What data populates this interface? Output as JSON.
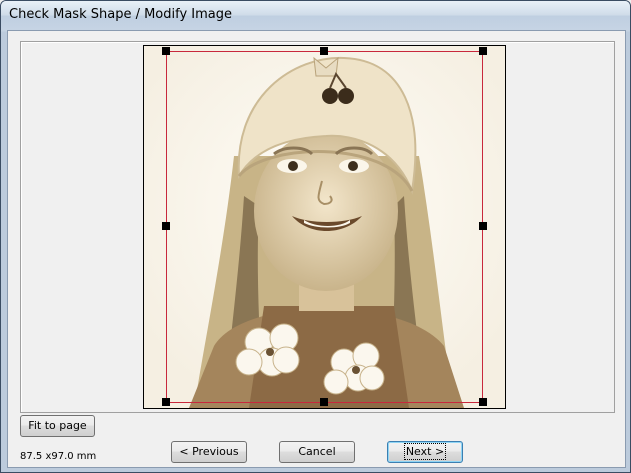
{
  "window": {
    "title": "Check Mask Shape / Modify Image"
  },
  "buttons": {
    "fit_to_page": "Fit to page",
    "previous": "< Previous",
    "cancel": "Cancel",
    "next": "Next >"
  },
  "status": {
    "dimensions": "87.5 x97.0 mm"
  },
  "colors": {
    "mask_outline": "#c8283c",
    "handle": "#000000",
    "photo_tone": "#d7c9a8"
  },
  "image": {
    "description_icon": "portrait-photo"
  }
}
